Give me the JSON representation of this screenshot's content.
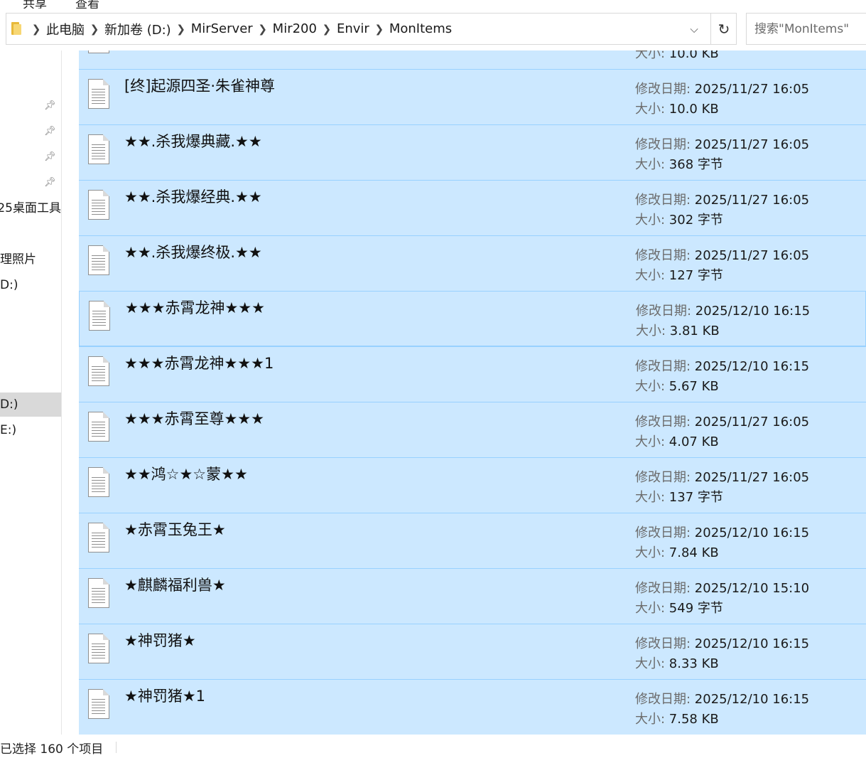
{
  "ribbon": {
    "tab_1": "共享",
    "tab_2": "查看"
  },
  "address_bar": {
    "crumbs": [
      "此电脑",
      "新加卷 (D:)",
      "MirServer",
      "Mir200",
      "Envir",
      "MonItems"
    ]
  },
  "search": {
    "placeholder": "搜索\"MonItems\""
  },
  "nav": {
    "items": [
      {
        "label": "25桌面工具"
      },
      {
        "label": "理照片"
      },
      {
        "label": "D:)"
      },
      {
        "label": "D:)"
      },
      {
        "label": "E:)"
      }
    ]
  },
  "labels": {
    "modified": "修改日期: ",
    "size": "大小: "
  },
  "files": [
    {
      "name": "",
      "modified": "",
      "size": "10.0 KB"
    },
    {
      "name": "[终]起源四圣·朱雀神尊",
      "modified": "2025/11/27 16:05",
      "size": "10.0 KB"
    },
    {
      "name": "★★.杀我爆典藏.★★",
      "modified": "2025/11/27 16:05",
      "size": "368 字节"
    },
    {
      "name": "★★.杀我爆经典.★★",
      "modified": "2025/11/27 16:05",
      "size": "302 字节"
    },
    {
      "name": "★★.杀我爆终极.★★",
      "modified": "2025/11/27 16:05",
      "size": "127 字节"
    },
    {
      "name": "★★★赤霄龙神★★★",
      "modified": "2025/12/10 16:15",
      "size": "3.81 KB"
    },
    {
      "name": "★★★赤霄龙神★★★1",
      "modified": "2025/12/10 16:15",
      "size": "5.67 KB"
    },
    {
      "name": "★★★赤霄至尊★★★",
      "modified": "2025/11/27 16:05",
      "size": "4.07 KB"
    },
    {
      "name": "★★鸿☆★☆蒙★★",
      "modified": "2025/11/27 16:05",
      "size": "137 字节"
    },
    {
      "name": "★赤霄玉兔王★",
      "modified": "2025/12/10 16:15",
      "size": "7.84 KB"
    },
    {
      "name": "★麒麟福利兽★",
      "modified": "2025/12/10 15:10",
      "size": "549 字节"
    },
    {
      "name": "★神罚猪★",
      "modified": "2025/12/10 16:15",
      "size": "8.33 KB"
    },
    {
      "name": "★神罚猪★1",
      "modified": "2025/12/10 16:15",
      "size": "7.58 KB"
    }
  ],
  "status": {
    "text": "已选择 160 个项目"
  },
  "colors": {
    "selection": "#cce8ff",
    "selection_border": "#99d1ff",
    "nav_selected": "#d9d9d9"
  }
}
